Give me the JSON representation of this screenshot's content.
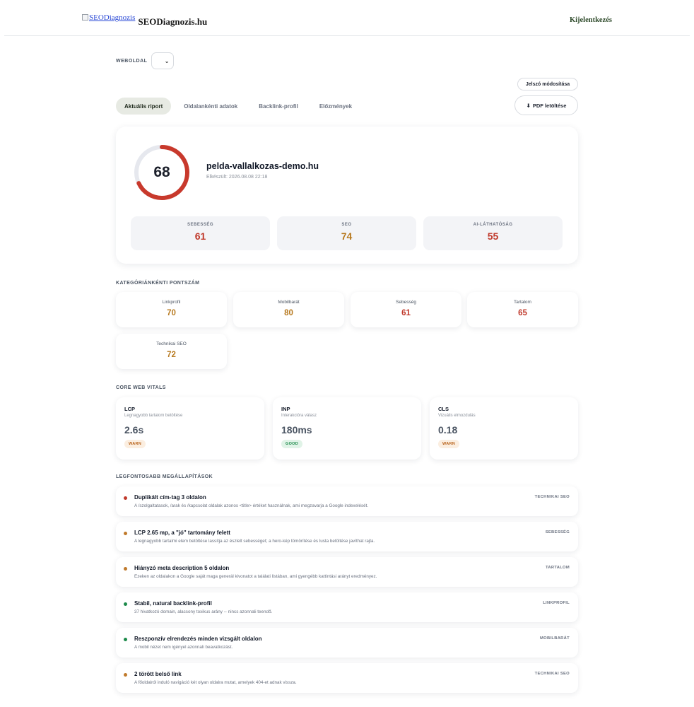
{
  "header": {
    "logo_alt": "SEODiagnozis",
    "brand_name": "SEODiagnozis.hu",
    "logout_label": "Kijelentkezés"
  },
  "site_selector": {
    "label": "WEBOLDAL",
    "value": ""
  },
  "buttons": {
    "password_change": "Jelszó módosítása",
    "pdf_download": "PDF letöltése"
  },
  "tabs": [
    {
      "label": "Aktuális riport",
      "active": true
    },
    {
      "label": "Oldalankénti adatok",
      "active": false
    },
    {
      "label": "Backlink-profil",
      "active": false
    },
    {
      "label": "Előzmények",
      "active": false
    }
  ],
  "summary": {
    "score": "68",
    "score_fraction": 0.68,
    "domain": "pelda-vallalkozas-demo.hu",
    "created": "Elkészült: 2026.08.08 22:18",
    "metrics": [
      {
        "label": "SEBESSÉG",
        "value": "61",
        "color": "#c0392b"
      },
      {
        "label": "SEO",
        "value": "74",
        "color": "#b7791f"
      },
      {
        "label": "AI-LÁTHATÓSÁG",
        "value": "55",
        "color": "#c0392b"
      }
    ]
  },
  "categories": {
    "title": "KATEGÓRIÁNKÉNTI PONTSZÁM",
    "items": [
      {
        "label": "Linkprofil",
        "value": "70",
        "color": "#b7791f"
      },
      {
        "label": "Mobilbarát",
        "value": "80",
        "color": "#b7791f"
      },
      {
        "label": "Sebesség",
        "value": "61",
        "color": "#c0392b"
      },
      {
        "label": "Tartalom",
        "value": "65",
        "color": "#c0392b"
      },
      {
        "label": "Technikai SEO",
        "value": "72",
        "color": "#b7791f"
      }
    ]
  },
  "vitals": {
    "title": "CORE WEB VITALS",
    "items": [
      {
        "name": "LCP",
        "desc": "Legnagyobb tartalom betöltése",
        "value": "2.6s",
        "status": "WARN"
      },
      {
        "name": "INP",
        "desc": "Interakcióra válasz",
        "value": "180ms",
        "status": "GOOD"
      },
      {
        "name": "CLS",
        "desc": "Vizuális elmozdulás",
        "value": "0.18",
        "status": "WARN"
      }
    ]
  },
  "findings": {
    "title": "LEGFONTOSABB MEGÁLLAPÍTÁSOK",
    "items": [
      {
        "title": "Duplikált cím-tag 3 oldalon",
        "desc": "A /szolgaltatasok, /arak és /kapcsolat oldalak azonos <title> értéket használnak, ami megzavarja a Google indexelését.",
        "category": "TECHNIKAI SEO",
        "dot": "#c0392b"
      },
      {
        "title": "LCP 2.65 mp, a \"jó\" tartomány felett",
        "desc": "A legnagyobb tartalmi elem betöltése lassítja az észlelt sebességet; a hero-kép tömörítése és lusta betöltése javíthat rajta.",
        "category": "SEBESSÉG",
        "dot": "#c07a2c"
      },
      {
        "title": "Hiányzó meta description 5 oldalon",
        "desc": "Ezeken az oldalakon a Google saját maga generál kivonatot a találati listában, ami gyengébb kattintási arányt eredményez.",
        "category": "TARTALOM",
        "dot": "#c07a2c"
      },
      {
        "title": "Stabil, natural backlink-profil",
        "desc": "37 hivatkozó domain, alacsony toxikus arány -- nincs azonnali teendő.",
        "category": "LINKPROFIL",
        "dot": "#1c8a4a"
      },
      {
        "title": "Reszponzív elrendezés minden vizsgált oldalon",
        "desc": "A mobil nézet nem igényel azonnali beavatkozást.",
        "category": "MOBILBARÁT",
        "dot": "#1c8a4a"
      },
      {
        "title": "2 törött belső link",
        "desc": "A főoldalról induló navigáció két olyan oldalra mutat, amelyek 404-et adnak vissza.",
        "category": "TECHNIKAI SEO",
        "dot": "#c07a2c"
      }
    ]
  },
  "colors": {
    "gauge_arc": "#c8392c",
    "gauge_track": "#e6e8ee",
    "active_tab_bg": "#e7eae3"
  },
  "icons": {
    "select_chevron": "chevron-down-icon",
    "pdf": "download-icon",
    "logo": "broken-image-icon"
  }
}
